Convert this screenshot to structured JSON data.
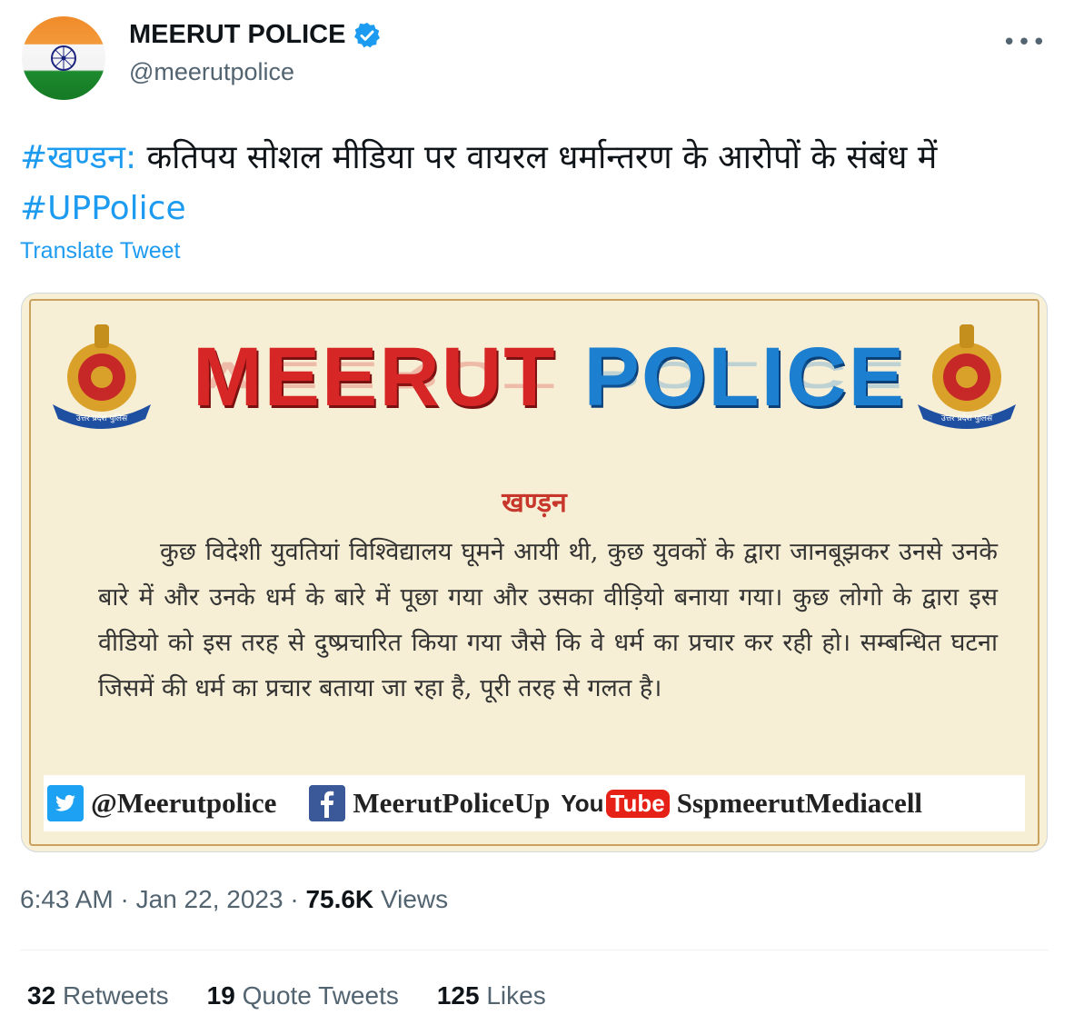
{
  "author": {
    "name": "MEERUT POLICE",
    "handle": "@meerutpolice",
    "verified_icon": "verified-badge-icon",
    "avatar_icon": "indian-flag-avatar"
  },
  "more_label": "•••",
  "tweet": {
    "hashtag_1": "#खण्डन:",
    "text": " कतिपय सोशल मीडिया पर वायरल धर्मान्तरण के आरोपों के संबंध में ",
    "hashtag_2": "#UPPolice",
    "translate_label": "Translate Tweet"
  },
  "media": {
    "banner_red": "MEERUT",
    "banner_blue": "POLICE",
    "heading": "खण्ड़न",
    "body": "कुछ विदेशी युवतियां विश्विद्यालय घूमने आयी थी, कुछ युवकों के द्वारा जानबूझकर उनसे उनके बारे में और उनके धर्म के बारे में पूछा गया और उसका वीड़ियो बनाया गया। कुछ लोगो के द्वारा इस वीडियो को इस तरह से दुष्प्रचारित किया गया जैसे कि वे धर्म का प्रचार कर रही हो। सम्बन्धित घटना जिसमें की धर्म का प्रचार बताया जा रहा है, पूरी तरह से गलत है।",
    "emblem_text": "उत्तर प्रदेश पुलिस",
    "twitter_handle": "@Meerutpolice",
    "facebook_handle": "MeerutPoliceUp",
    "youtube_you": "You",
    "youtube_tube": "Tube",
    "youtube_handle": "SspmeerutMediacell",
    "colors": {
      "red": "#d62626",
      "blue": "#1c7fd0",
      "bg": "#f7efd5"
    }
  },
  "meta": {
    "time": "6:43 AM",
    "sep": "·",
    "date": "Jan 22, 2023",
    "views_count": "75.6K",
    "views_label": "Views"
  },
  "stats": {
    "retweets_count": "32",
    "retweets_label": "Retweets",
    "quotes_count": "19",
    "quotes_label": "Quote Tweets",
    "likes_count": "125",
    "likes_label": "Likes"
  },
  "colors": {
    "accent": "#1d9bf0",
    "muted": "#536471",
    "text": "#0f1419"
  }
}
